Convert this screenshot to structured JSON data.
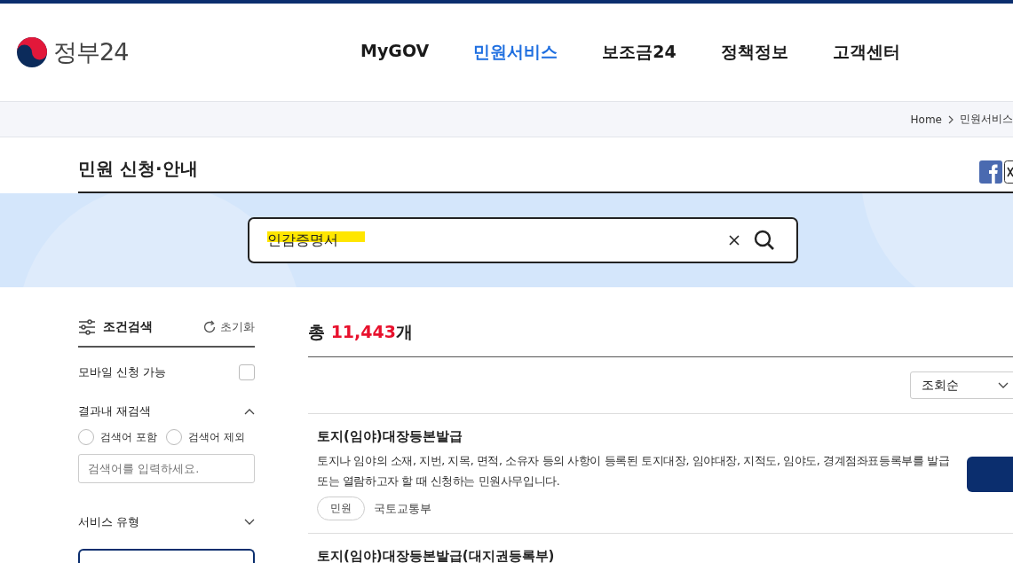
{
  "header": {
    "logo_text": "정부24",
    "nav": [
      {
        "label": "MyGOV",
        "selected": false
      },
      {
        "label": "민원서비스",
        "selected": true
      },
      {
        "label": "보조금24",
        "selected": false
      },
      {
        "label": "정책정보",
        "selected": false
      },
      {
        "label": "고객센터",
        "selected": false
      }
    ]
  },
  "breadcrumb": [
    "Home",
    "민원서비스"
  ],
  "page_title": "민원 신청·안내",
  "search": {
    "value": "인감증명서",
    "highlighted": true
  },
  "filter": {
    "title": "조건검색",
    "reset": "초기화",
    "mobile": {
      "label": "모바일 신청 가능",
      "checked": false
    },
    "research": {
      "label": "결과내 재검색",
      "expanded": true,
      "options": [
        {
          "label": "검색어 포함",
          "selected": false
        },
        {
          "label": "검색어 제외",
          "selected": false
        }
      ],
      "placeholder": "검색어를 입력하세요."
    },
    "service_type": {
      "label": "서비스 유형",
      "expanded": false
    }
  },
  "results": {
    "prefix": "총",
    "count": "11,443",
    "suffix": "개",
    "sort": "조회순",
    "items": [
      {
        "title": "토지(임야)대장등본발급",
        "description": "토지나 임야의 소재, 지번, 지목, 면적, 소유자 등의 사항이 등록된 토지대장, 임야대장, 지적도, 임야도, 경계점좌표등록부를 발급 또는 열람하고자 할 때 신청하는 민원사무입니다.",
        "tag": "민원",
        "agency": "국토교통부"
      },
      {
        "title": "토지(임야)대장등본발급(대지권등록부)"
      }
    ]
  }
}
